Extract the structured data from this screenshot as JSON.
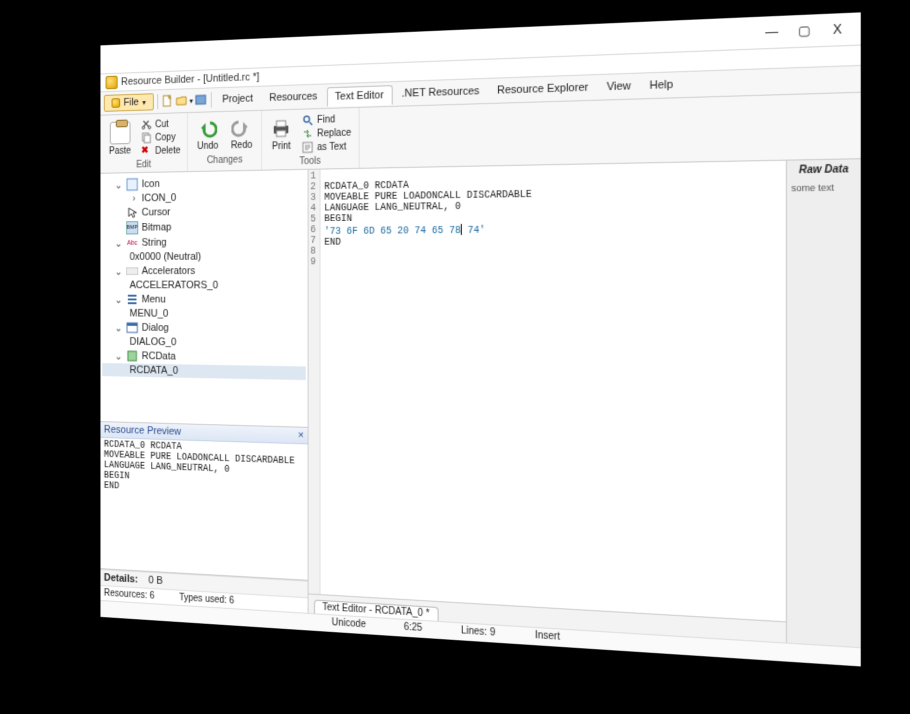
{
  "window": {
    "title": "Resource Builder - [Untitled.rc *]",
    "controls": {
      "min": "—",
      "max": "▢",
      "close": "X"
    }
  },
  "menubar": {
    "file": "File",
    "tabs": {
      "project": "Project",
      "resources": "Resources",
      "text_editor": "Text Editor",
      "net_resources": ".NET Resources",
      "resource_explorer": "Resource Explorer",
      "view": "View",
      "help": "Help"
    }
  },
  "quick_icons": [
    "new-icon",
    "open-icon",
    "recent-icon"
  ],
  "ribbon": {
    "edit": {
      "label": "Edit",
      "paste": "Paste",
      "cut": "Cut",
      "copy": "Copy",
      "delete": "Delete"
    },
    "changes": {
      "label": "Changes",
      "undo": "Undo",
      "redo": "Redo"
    },
    "tools": {
      "label": "Tools",
      "print": "Print",
      "find": "Find",
      "replace": "Replace",
      "as_text": "as Text"
    }
  },
  "tree": {
    "icon": {
      "label": "Icon",
      "child": "ICON_0"
    },
    "cursor": {
      "label": "Cursor"
    },
    "bitmap": {
      "label": "Bitmap"
    },
    "string": {
      "label": "String",
      "child": "0x0000 (Neutral)"
    },
    "accelerators": {
      "label": "Accelerators",
      "child": "ACCELERATORS_0"
    },
    "menu": {
      "label": "Menu",
      "child": "MENU_0"
    },
    "dialog": {
      "label": "Dialog",
      "child": "DIALOG_0"
    },
    "rcdata": {
      "label": "RCData",
      "child": "RCDATA_0"
    }
  },
  "preview": {
    "title": "Resource Preview",
    "body": "RCDATA_0 RCDATA\nMOVEABLE PURE LOADONCALL DISCARDABLE\nLANGUAGE LANG_NEUTRAL, 0\nBEGIN\nEND"
  },
  "details": {
    "label": "Details:",
    "value": "0 B"
  },
  "left_status": {
    "resources": "Resources: 6",
    "types": "Types used: 6"
  },
  "editor": {
    "lines": [
      "",
      "RCDATA_0 RCDATA",
      "MOVEABLE PURE LOADONCALL DISCARDABLE",
      "LANGUAGE LANG_NEUTRAL, 0",
      "BEGIN",
      "'73 6F 6D 65 20 74 65 78 74'",
      "END",
      "",
      ""
    ],
    "tab_label": "Text Editor - RCDATA_0 *"
  },
  "side_panel": {
    "title": "Raw Data",
    "sample": "some text"
  },
  "status": {
    "encoding": "Unicode",
    "pos": "6:25",
    "lines": "Lines: 9",
    "mode": "Insert"
  }
}
